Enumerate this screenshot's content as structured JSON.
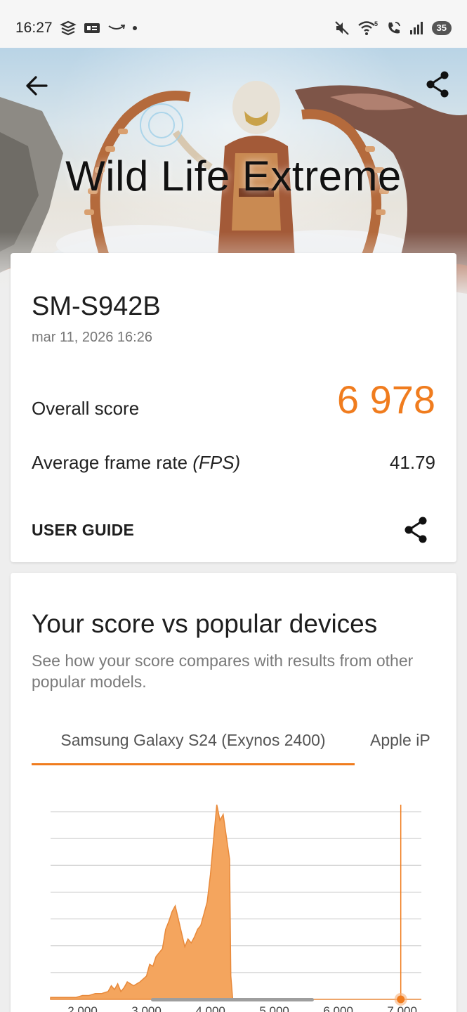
{
  "status_bar": {
    "time": "16:27",
    "left_icons": [
      "sim-card-icon",
      "gallery-icon",
      "amazon-icon",
      "notification-dot-icon"
    ],
    "right_icons": [
      "mute-icon",
      "wifi-icon",
      "wifi-call-icon",
      "signal-icon"
    ],
    "battery": "35"
  },
  "hero": {
    "title": "Wild Life Extreme",
    "back_icon": "arrow-left-icon",
    "share_icon": "share-icon"
  },
  "result": {
    "device": "SM-S942B",
    "timestamp": "mar 11, 2026 16:26",
    "overall_label": "Overall score",
    "overall_value": "6 978",
    "fps_label_prefix": "Average frame rate ",
    "fps_label_unit": "(FPS)",
    "fps_value": "41.79",
    "user_guide": "USER GUIDE",
    "share_icon": "share-icon"
  },
  "comparison": {
    "title": "Your score vs popular devices",
    "subtitle": "See how your score compares with results from other popular models.",
    "tabs": [
      "Samsung Galaxy S24 (Exynos 2400)",
      "Apple iP"
    ],
    "active_tab": 0
  },
  "colors": {
    "accent": "#f07c1e",
    "histogram_fill": "#f4a55e",
    "text_primary": "#1e1e1e",
    "text_secondary": "#777777"
  },
  "chart_data": {
    "type": "area",
    "title": "",
    "xlabel": "",
    "ylabel": "",
    "x_tick_labels": [
      "2 000",
      "3 000",
      "4 000",
      "5 000",
      "6 000",
      "7 000"
    ],
    "xlim": [
      1500,
      7300
    ],
    "ylim": [
      0,
      100
    ],
    "grid": true,
    "series": [
      {
        "x": [
          1500,
          1900,
          2000,
          2100,
          2200,
          2300,
          2400,
          2450,
          2500,
          2550,
          2600,
          2650,
          2700,
          2800,
          2900,
          3000,
          3050,
          3100,
          3150,
          3200,
          3250,
          3300,
          3350,
          3400,
          3450,
          3500,
          3550,
          3600,
          3650,
          3700,
          3750,
          3800,
          3850,
          3900,
          3950,
          4000,
          4050,
          4100,
          4150,
          4200,
          4300,
          4320,
          4350,
          5000,
          7300
        ],
        "y": [
          1,
          1,
          2,
          2,
          3,
          3,
          4,
          7,
          5,
          8,
          4,
          6,
          9,
          7,
          9,
          12,
          18,
          17,
          22,
          24,
          26,
          36,
          40,
          45,
          48,
          41,
          34,
          27,
          31,
          29,
          32,
          36,
          38,
          44,
          50,
          64,
          82,
          100,
          92,
          95,
          72,
          12,
          0,
          0,
          0
        ]
      }
    ],
    "score_marker": 6978
  }
}
